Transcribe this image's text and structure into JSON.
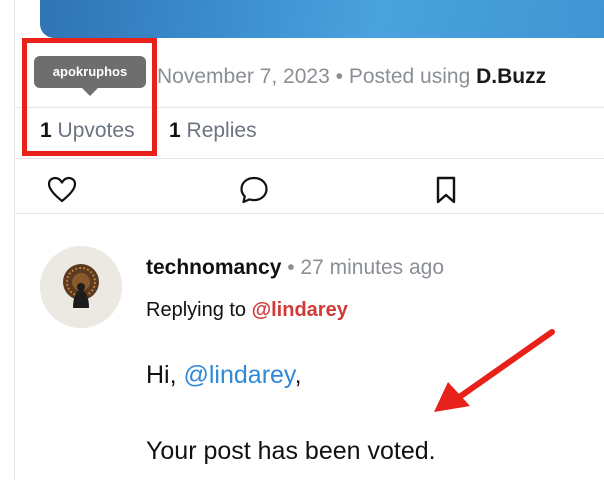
{
  "post": {
    "date": "November 7, 2023",
    "separator": "•",
    "posted_using": "Posted using",
    "app_name": "D.Buzz",
    "tooltip": "apokruphos",
    "upvotes_count": "1",
    "upvotes_label": "Upvotes",
    "replies_count": "1",
    "replies_label": "Replies"
  },
  "actions": {
    "icons": [
      "heart-icon",
      "comment-icon",
      "bookmark-icon"
    ]
  },
  "reply": {
    "author": "technomancy",
    "separator": "•",
    "time": "27 minutes ago",
    "replying_to_label": "Replying to",
    "replying_to_user": "@lindarey",
    "greeting_prefix": "Hi, ",
    "greeting_mention": "@lindarey",
    "greeting_suffix": ",",
    "message": "Your post has been voted."
  },
  "colors": {
    "annotation_red": "#e8211a",
    "mention_red": "#d23a3a",
    "mention_blue": "#2f88d8",
    "muted_gray": "#8a8f95"
  }
}
